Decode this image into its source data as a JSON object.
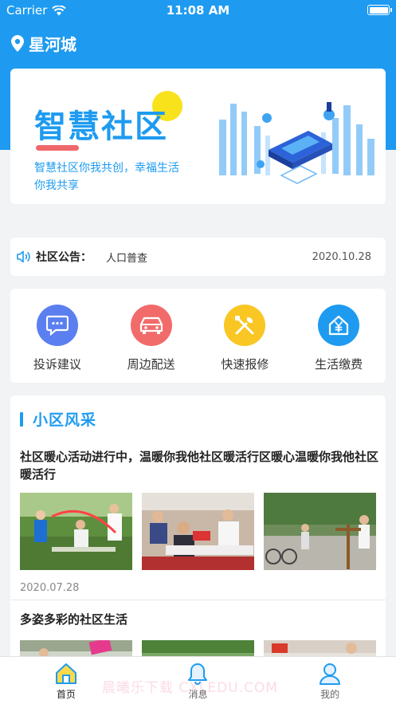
{
  "status_bar": {
    "carrier": "Carrier",
    "time": "11:08 AM"
  },
  "header": {
    "location": "星河城"
  },
  "banner": {
    "title": "智慧社区",
    "subtitle": "智慧社区你我共创，幸福生活你我共享"
  },
  "notice": {
    "label": "社区公告：",
    "title": "人口普查",
    "date": "2020.10.28"
  },
  "services": [
    {
      "label": "投诉建议",
      "icon": "chat-bubble-icon",
      "color": "#5b7ff0"
    },
    {
      "label": "周边配送",
      "icon": "car-icon",
      "color": "#f26b6b"
    },
    {
      "label": "快速报修",
      "icon": "tools-icon",
      "color": "#f9c623"
    },
    {
      "label": "生活缴费",
      "icon": "yen-house-icon",
      "color": "#1e9bf0"
    }
  ],
  "news": {
    "section_title": "小区风采",
    "items": [
      {
        "title": "社区暖心活动进行中，温暖你我他社区暖活行区暖心温暖你我他社区暖活行",
        "date": "2020.07.28"
      },
      {
        "title": "多姿多彩的社区生活"
      }
    ]
  },
  "tabbar": [
    {
      "label": "首页",
      "icon": "home-icon",
      "active": true
    },
    {
      "label": "消息",
      "icon": "bell-icon",
      "active": false
    },
    {
      "label": "我的",
      "icon": "user-icon",
      "active": false
    }
  ],
  "watermark": "晨曦乐下载 CXLEDU.COM",
  "colors": {
    "primary": "#1e9bf0",
    "accent_red": "#f0676b",
    "sun_yellow": "#f8e21c"
  }
}
